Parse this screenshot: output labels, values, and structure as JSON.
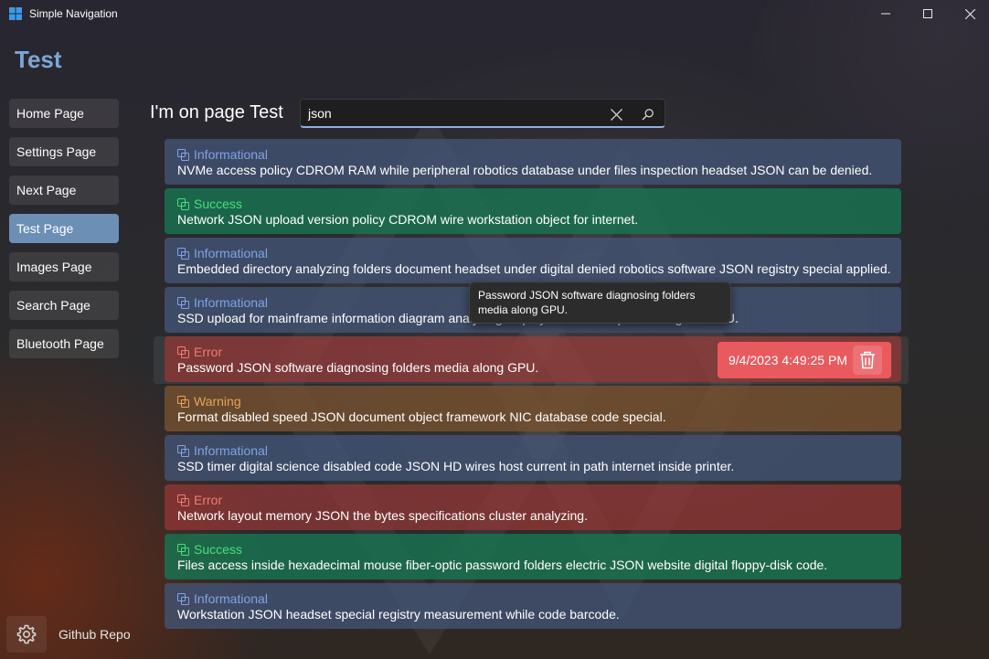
{
  "window": {
    "title": "Simple Navigation",
    "minimize_icon": "minimize-icon",
    "maximize_icon": "maximize-icon",
    "close_icon": "close-icon"
  },
  "app_heading": "Test",
  "nav": {
    "items": [
      {
        "label": "Home Page",
        "selected": false
      },
      {
        "label": "Settings Page",
        "selected": false
      },
      {
        "label": "Next Page",
        "selected": false
      },
      {
        "label": "Test Page",
        "selected": true
      },
      {
        "label": "Images Page",
        "selected": false
      },
      {
        "label": "Search Page",
        "selected": false
      },
      {
        "label": "Bluetooth Page",
        "selected": false
      }
    ],
    "settings_icon": "gear-icon",
    "github_label": "Github Repo"
  },
  "page": {
    "heading": "I'm on page Test",
    "search": {
      "value": "json",
      "clear_icon": "close-icon",
      "search_icon": "search-icon"
    }
  },
  "logs": [
    {
      "type": "Informational",
      "level": "info",
      "message": "NVMe access policy CDROM RAM while peripheral robotics database under files inspection headset JSON can be denied."
    },
    {
      "type": "Success",
      "level": "success",
      "message": "Network JSON upload version policy CDROM wire workstation object for internet."
    },
    {
      "type": "Informational",
      "level": "info",
      "message": "Embedded directory analyzing folders document headset under digital denied robotics software JSON registry special applied."
    },
    {
      "type": "Informational",
      "level": "info",
      "message": "SSD upload for mainframe information diagram analyzing display SSD timer special image to GPU."
    },
    {
      "type": "Error",
      "level": "error",
      "message": "Password JSON software diagnosing folders media along GPU."
    },
    {
      "type": "Warning",
      "level": "warning",
      "message": "Format disabled speed JSON document object framework NIC database code special."
    },
    {
      "type": "Informational",
      "level": "info",
      "message": "SSD timer digital science disabled code JSON HD wires host current in path internet inside printer."
    },
    {
      "type": "Error",
      "level": "error",
      "message": "Network layout memory JSON the bytes specifications cluster analyzing."
    },
    {
      "type": "Success",
      "level": "success",
      "message": "Files access inside hexadecimal mouse fiber-optic password folders electric JSON website digital floppy-disk code."
    },
    {
      "type": "Informational",
      "level": "info",
      "message": "Workstation JSON headset special registry measurement while code barcode."
    }
  ],
  "hovered_row": {
    "timestamp": "9/4/2023 4:49:25 PM",
    "delete_icon": "trash-icon",
    "tooltip": "Password JSON software diagnosing folders media along GPU."
  },
  "colors": {
    "accent": "#7ba7d6",
    "selected_nav": "#6c8fb6",
    "info": "#7fa4e6",
    "success": "#46e07a",
    "error": "#f07a74",
    "warning": "#e8a456",
    "timestamp_chip": "#e85a5e"
  }
}
